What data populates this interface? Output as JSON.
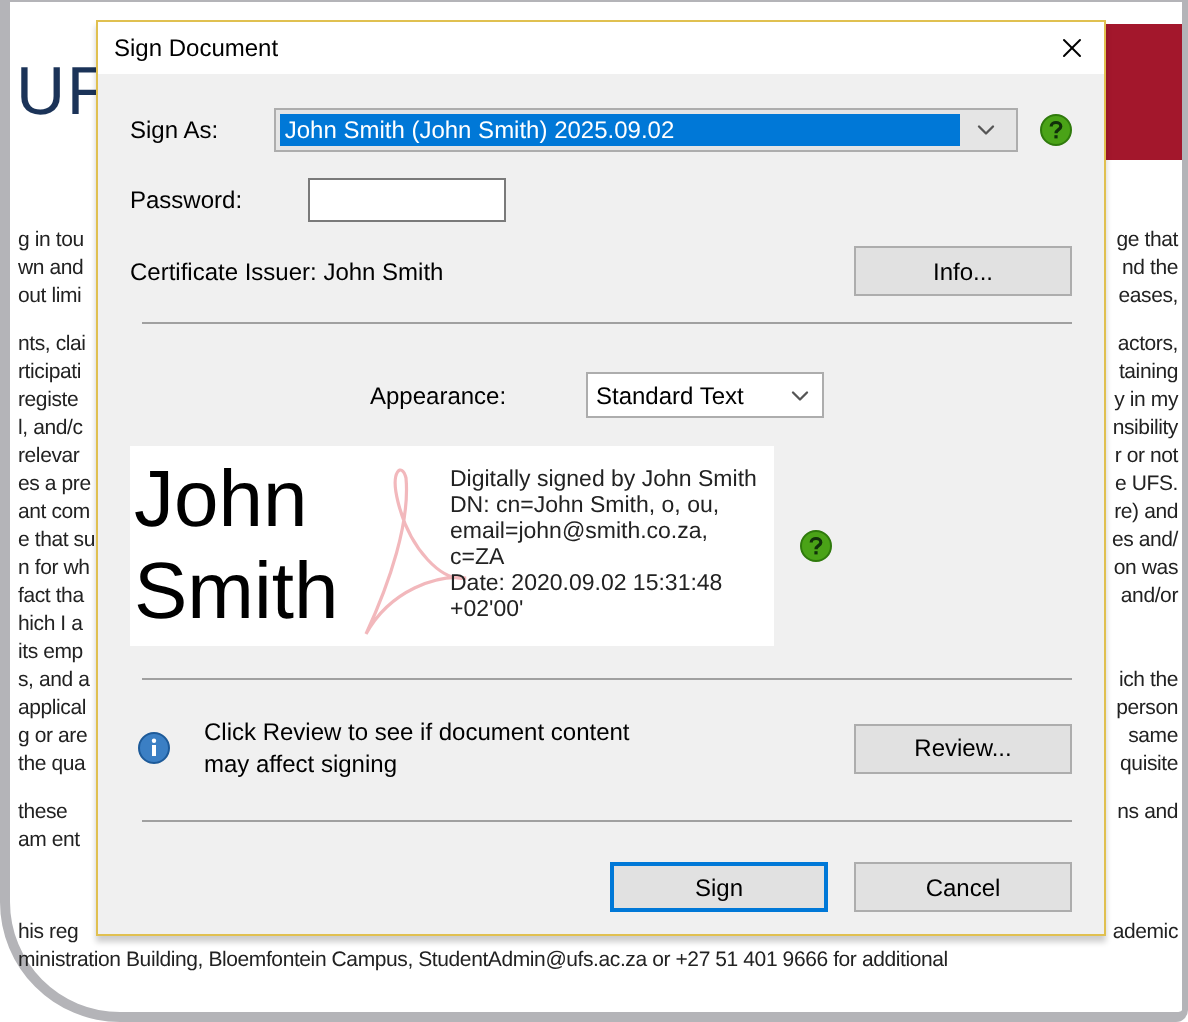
{
  "document": {
    "logo": "UF",
    "paragraphs": [
      [
        {
          "left": "g in tou",
          "right": "ge that"
        },
        {
          "left": "wn and",
          "right": "nd the"
        },
        {
          "left": "out limi",
          "right": "eases,"
        }
      ],
      [
        {
          "left": "nts, clai",
          "right": "actors,"
        },
        {
          "left": "rticipati",
          "right": "taining"
        },
        {
          "left": "registe",
          "right": "y in my"
        },
        {
          "left": "l, and/c",
          "right": "nsibility"
        },
        {
          "left": "relevar",
          "right": "r or not"
        },
        {
          "left": "es a pre",
          "right": "e UFS."
        },
        {
          "left": "ant com",
          "right": "re) and"
        },
        {
          "left": "e that su",
          "right": "es and/"
        },
        {
          "left": "n for wh",
          "right": "on was"
        },
        {
          "left": "fact tha",
          "right": "and/or"
        },
        {
          "left": "hich I a"
        },
        {
          "left": "its emp"
        },
        {
          "left": "s, and a",
          "right": "ich the"
        },
        {
          "left": "applical",
          "right": "person"
        },
        {
          "left": "g or are",
          "right": "same"
        },
        {
          "left": "the qua",
          "right": "quisite"
        }
      ],
      [
        {
          "left": "these",
          "right": "ns and"
        },
        {
          "left": "am ent"
        }
      ],
      [
        {
          "left": "his reg",
          "right": "ademic"
        },
        {
          "left": "ministration Building, Bloemfontein Campus, StudentAdmin@ufs.ac.za or +27 51 401 9666 for additional"
        }
      ]
    ]
  },
  "dialog": {
    "title": "Sign Document",
    "sign_as": {
      "label": "Sign As:",
      "value": "John Smith (John Smith) 2025.09.02",
      "selected": true
    },
    "password": {
      "label": "Password:"
    },
    "certificate_issuer": "Certificate Issuer: John Smith",
    "info_button": "Info...",
    "appearance": {
      "label": "Appearance:",
      "value": "Standard Text"
    },
    "preview": {
      "name_lines": [
        "John",
        "Smith"
      ],
      "details": [
        "Digitally signed by John Smith",
        "DN: cn=John Smith, o, ou,",
        "email=john@smith.co.za,",
        "c=ZA",
        "Date: 2020.09.02 15:31:48",
        "+02'00'"
      ]
    },
    "notice": {
      "text": "Click Review to see if document content may affect signing",
      "button": "Review..."
    },
    "buttons": [
      {
        "label": "Sign",
        "default": true
      },
      {
        "label": "Cancel",
        "default": false
      }
    ]
  }
}
